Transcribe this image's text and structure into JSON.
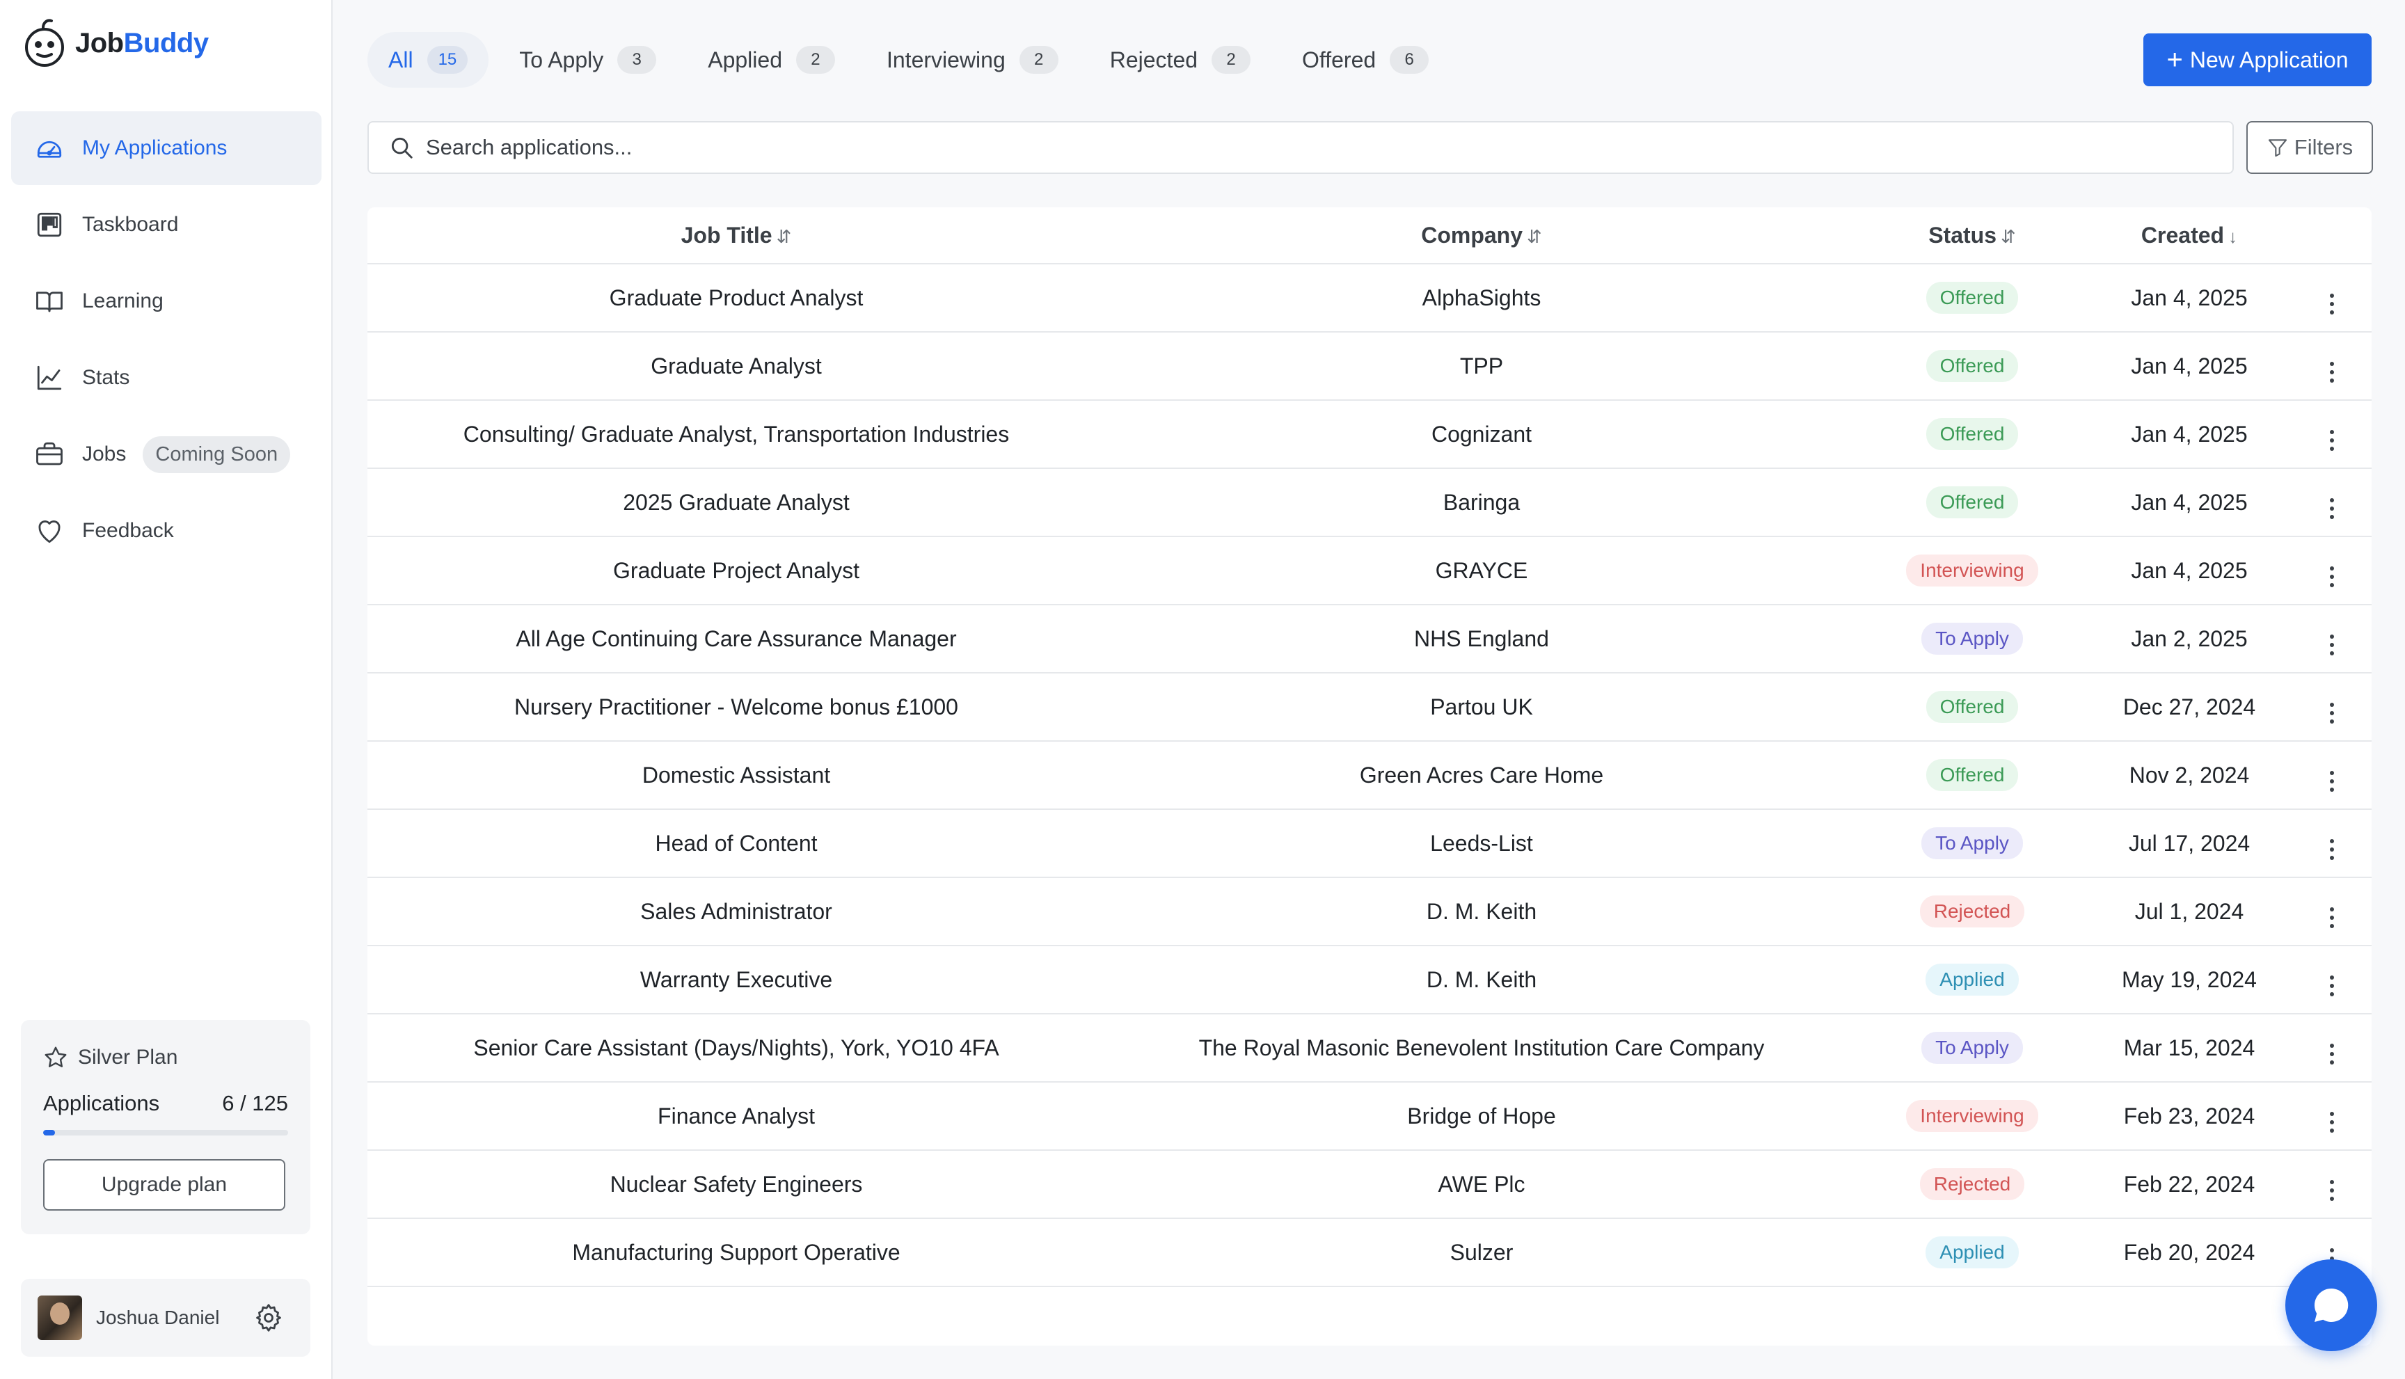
{
  "app": {
    "brand_part1": "Job",
    "brand_part2": "Buddy",
    "accent_color": "#2468e8"
  },
  "sidebar": {
    "items": [
      {
        "label": "My Applications",
        "icon": "gauge-icon",
        "active": true
      },
      {
        "label": "Taskboard",
        "icon": "kanban-icon"
      },
      {
        "label": "Learning",
        "icon": "book-icon"
      },
      {
        "label": "Stats",
        "icon": "chart-icon"
      },
      {
        "label": "Jobs",
        "icon": "briefcase-icon",
        "badge": "Coming Soon"
      },
      {
        "label": "Feedback",
        "icon": "heart-icon"
      }
    ],
    "plan": {
      "name": "Silver Plan",
      "apps_label": "Applications",
      "apps_value": "6 / 125",
      "used_fraction": 0.048,
      "upgrade_label": "Upgrade plan"
    },
    "user": {
      "name": "Joshua Daniel"
    }
  },
  "tabs": [
    {
      "label": "All",
      "count": "15",
      "active": true
    },
    {
      "label": "To Apply",
      "count": "3"
    },
    {
      "label": "Applied",
      "count": "2"
    },
    {
      "label": "Interviewing",
      "count": "2"
    },
    {
      "label": "Rejected",
      "count": "2"
    },
    {
      "label": "Offered",
      "count": "6"
    }
  ],
  "new_button_label": "New Application",
  "search": {
    "placeholder": "Search applications..."
  },
  "filters_label": "Filters",
  "table": {
    "headers": {
      "job_title": "Job Title",
      "company": "Company",
      "status": "Status",
      "created": "Created"
    },
    "sort_icons": {
      "job_title": "⇵",
      "company": "⇵",
      "status": "⇵",
      "created": "↓"
    },
    "rows": [
      {
        "title": "Graduate Product Analyst",
        "company": "AlphaSights",
        "status": "Offered",
        "created": "Jan 4, 2025"
      },
      {
        "title": "Graduate Analyst",
        "company": "TPP",
        "status": "Offered",
        "created": "Jan 4, 2025"
      },
      {
        "title": "Consulting/ Graduate Analyst, Transportation Industries",
        "company": "Cognizant",
        "status": "Offered",
        "created": "Jan 4, 2025"
      },
      {
        "title": "2025 Graduate Analyst",
        "company": "Baringa",
        "status": "Offered",
        "created": "Jan 4, 2025"
      },
      {
        "title": "Graduate Project Analyst",
        "company": "GRAYCE",
        "status": "Interviewing",
        "created": "Jan 4, 2025"
      },
      {
        "title": "All Age Continuing Care Assurance Manager",
        "company": "NHS England",
        "status": "To Apply",
        "created": "Jan 2, 2025"
      },
      {
        "title": "Nursery Practitioner - Welcome bonus £1000",
        "company": "Partou UK",
        "status": "Offered",
        "created": "Dec 27, 2024"
      },
      {
        "title": "Domestic Assistant",
        "company": "Green Acres Care Home",
        "status": "Offered",
        "created": "Nov 2, 2024"
      },
      {
        "title": "Head of Content",
        "company": "Leeds-List",
        "status": "To Apply",
        "created": "Jul 17, 2024"
      },
      {
        "title": "Sales Administrator",
        "company": "D. M. Keith",
        "status": "Rejected",
        "created": "Jul 1, 2024"
      },
      {
        "title": "Warranty Executive",
        "company": "D. M. Keith",
        "status": "Applied",
        "created": "May 19, 2024"
      },
      {
        "title": "Senior Care Assistant (Days/Nights), York, YO10 4FA",
        "company": "The Royal Masonic Benevolent Institution Care Company",
        "status": "To Apply",
        "created": "Mar 15, 2024"
      },
      {
        "title": "Finance Analyst",
        "company": "Bridge of Hope",
        "status": "Interviewing",
        "created": "Feb 23, 2024"
      },
      {
        "title": "Nuclear Safety Engineers",
        "company": "AWE Plc",
        "status": "Rejected",
        "created": "Feb 22, 2024"
      },
      {
        "title": "Manufacturing Support Operative",
        "company": "Sulzer",
        "status": "Applied",
        "created": "Feb 20, 2024"
      }
    ]
  },
  "status_colors": {
    "Offered": "#3a9a55",
    "Interviewing": "#d25454",
    "To Apply": "#5a55c4",
    "Rejected": "#d25454",
    "Applied": "#2d8fb3"
  }
}
